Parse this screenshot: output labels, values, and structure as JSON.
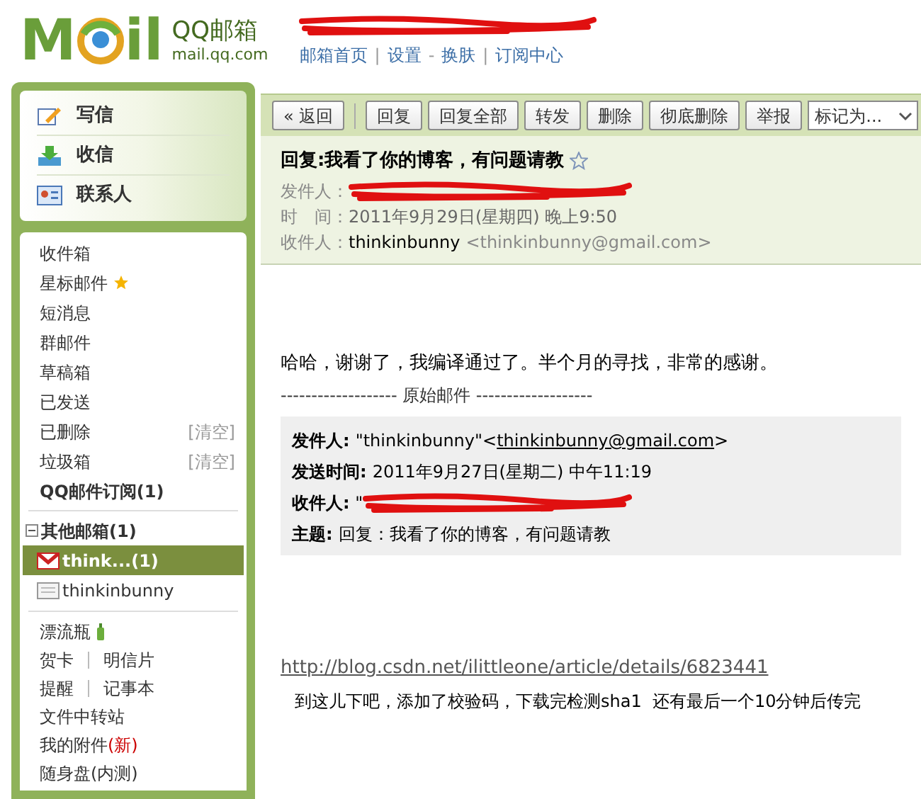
{
  "header": {
    "logo": {
      "letters_left": "M",
      "letters_right": "il",
      "name": "QQ邮箱",
      "domain": "mail.qq.com"
    },
    "links": [
      {
        "label": "邮箱首页",
        "sep": "|"
      },
      {
        "label": "设置",
        "sep": "-"
      },
      {
        "label": "换肤",
        "sep": "|"
      },
      {
        "label": "订阅中心"
      }
    ]
  },
  "quick_actions": [
    {
      "label": "写信",
      "kind": "compose"
    },
    {
      "label": "收信",
      "kind": "receive"
    },
    {
      "label": "联系人",
      "kind": "contacts"
    }
  ],
  "folders": [
    {
      "label": "收件箱",
      "kind": "plain"
    },
    {
      "label": "星标邮件",
      "kind": "starred"
    },
    {
      "label": "短消息",
      "kind": "plain"
    },
    {
      "label": "群邮件",
      "kind": "plain"
    },
    {
      "label": "草稿箱",
      "kind": "plain"
    },
    {
      "label": "已发送",
      "kind": "plain"
    },
    {
      "label": "已删除",
      "kind": "clearable",
      "action": "[清空]"
    },
    {
      "label": "垃圾箱",
      "kind": "clearable",
      "action": "[清空]"
    },
    {
      "label": "QQ邮件订阅(1)",
      "kind": "bold"
    }
  ],
  "other_accounts": {
    "label": "其他邮箱(1)",
    "expanded": true,
    "items": [
      {
        "label": "think...(1)",
        "kind": "gmail",
        "selected": true
      },
      {
        "label": "thinkinbunny",
        "kind": "mail",
        "selected": false
      }
    ]
  },
  "tools": [
    {
      "kind": "bottle",
      "label": "漂流瓶"
    },
    {
      "kind": "pair",
      "label": "贺卡",
      "label2": "明信片"
    },
    {
      "kind": "pair",
      "label": "提醒",
      "label2": "记事本"
    },
    {
      "kind": "plain",
      "label": "文件中转站"
    },
    {
      "kind": "badge",
      "label": "我的附件",
      "badge": "(新)"
    },
    {
      "kind": "plain",
      "label": "随身盘(内测)"
    }
  ],
  "toolbar": {
    "buttons": [
      "« 返回",
      "回复",
      "回复全部",
      "转发",
      "删除",
      "彻底删除",
      "举报"
    ],
    "dropdown": "标记为..."
  },
  "message": {
    "subject": "回复:我看了你的博客，有问题请教",
    "starred": false,
    "fields": [
      {
        "label": "发件人：",
        "kind": "redacted"
      },
      {
        "label": "时　间：",
        "kind": "text",
        "value": "2011年9月29日(星期四) 晚上9:50"
      },
      {
        "label": "收件人：",
        "kind": "contact",
        "name": "thinkinbunny",
        "address": "<thinkinbunny@gmail.com>"
      }
    ],
    "body": "哈哈，谢谢了，我编译通过了。半个月的寻找，非常的感谢。",
    "divider": "------------------- 原始邮件 -------------------",
    "quote": [
      {
        "label": "发件人:",
        "kind": "contact",
        "value": "\"thinkinbunny\"<",
        "link": "thinkinbunny@gmail.com",
        "after": ">"
      },
      {
        "label": "发送时间:",
        "kind": "text",
        "value": "2011年9月27日(星期二) 中午11:19"
      },
      {
        "label": "**收件人:** \"",
        "kind": "redacted"
      },
      {
        "label": "主题:",
        "kind": "text",
        "value": "回复：我看了你的博客，有问题请教"
      }
    ],
    "link": "http://blog.csdn.net/ilittleone/article/details/6823441",
    "note": "到这儿下吧，添加了校验码，下载完检测sha1  还有最后一个10分钟后传完"
  }
}
